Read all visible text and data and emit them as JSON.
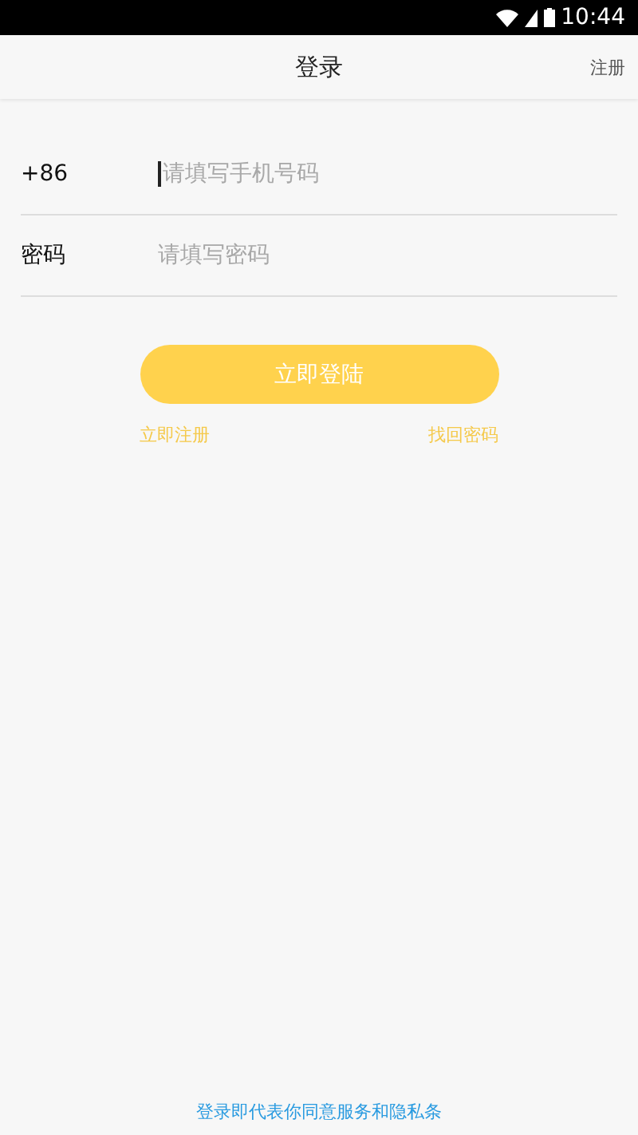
{
  "status_bar": {
    "time": "10:44"
  },
  "header": {
    "title": "登录",
    "action": "注册"
  },
  "fields": [
    {
      "label": "+86",
      "placeholder": "请填写手机号码",
      "focused": true
    },
    {
      "label": "密码",
      "placeholder": "请填写密码",
      "focused": false
    }
  ],
  "login_button": "立即登陆",
  "links": [
    "立即注册",
    "找回密码"
  ],
  "footer": "登录即代表你同意服务和隐私条"
}
